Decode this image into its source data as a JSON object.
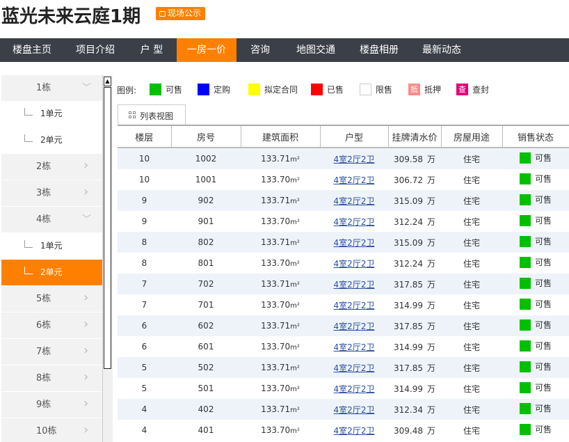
{
  "header": {
    "title": "蓝光未来云庭1期",
    "badge": "现场公示"
  },
  "nav": {
    "items": [
      {
        "label": "楼盘主页"
      },
      {
        "label": "项目介绍"
      },
      {
        "label": "户 型"
      },
      {
        "label": "一房一价"
      },
      {
        "label": "咨询"
      },
      {
        "label": "地图交通"
      },
      {
        "label": "楼盘相册"
      },
      {
        "label": "最新动态"
      }
    ],
    "active_color": "#ff8000",
    "bg_color": "#3b3f48"
  },
  "sidebar": {
    "items": [
      {
        "type": "building",
        "label": "1栋",
        "expanded": true
      },
      {
        "type": "unit",
        "label": "1单元"
      },
      {
        "type": "unit",
        "label": "2单元"
      },
      {
        "type": "building",
        "label": "2栋",
        "expanded": false
      },
      {
        "type": "building",
        "label": "3栋",
        "expanded": false
      },
      {
        "type": "building",
        "label": "4栋",
        "expanded": true
      },
      {
        "type": "unit",
        "label": "1单元"
      },
      {
        "type": "unit",
        "label": "2单元",
        "active": true
      },
      {
        "type": "building",
        "label": "5栋",
        "expanded": false
      },
      {
        "type": "building",
        "label": "6栋",
        "expanded": false
      },
      {
        "type": "building",
        "label": "7栋",
        "expanded": false
      },
      {
        "type": "building",
        "label": "8栋",
        "expanded": false
      },
      {
        "type": "building",
        "label": "9栋",
        "expanded": false
      },
      {
        "type": "building",
        "label": "10栋",
        "expanded": false
      }
    ]
  },
  "legend": {
    "title": "图例:",
    "items": [
      {
        "label": "可售",
        "color": "#00c000",
        "glyph": ""
      },
      {
        "label": "定购",
        "color": "#0000ff",
        "glyph": ""
      },
      {
        "label": "拟定合同",
        "color": "#ffff00",
        "glyph": ""
      },
      {
        "label": "已售",
        "color": "#ff0000",
        "glyph": ""
      },
      {
        "label": "限售",
        "color": "#ffffff",
        "glyph": ""
      },
      {
        "label": "抵押",
        "color": "#ff8a8a",
        "glyph": "抵"
      },
      {
        "label": "查封",
        "color": "#e0007a",
        "glyph": "查"
      }
    ]
  },
  "tab": {
    "label": "列表视图"
  },
  "table": {
    "columns": [
      "楼层",
      "房号",
      "建筑面积",
      "户型",
      "挂牌清水价",
      "房屋用途",
      "销售状态"
    ],
    "area_unit": "m²",
    "price_unit": "万",
    "rows": [
      {
        "floor": "10",
        "room": "1002",
        "area": "133.71",
        "layout": "4室2厅2卫",
        "price": "309.58",
        "usage": "住宅",
        "status": "可售",
        "status_color": "#00c000"
      },
      {
        "floor": "10",
        "room": "1001",
        "area": "133.70",
        "layout": "4室2厅2卫",
        "price": "306.72",
        "usage": "住宅",
        "status": "可售",
        "status_color": "#00c000"
      },
      {
        "floor": "9",
        "room": "902",
        "area": "133.71",
        "layout": "4室2厅2卫",
        "price": "315.09",
        "usage": "住宅",
        "status": "可售",
        "status_color": "#00c000"
      },
      {
        "floor": "9",
        "room": "901",
        "area": "133.70",
        "layout": "4室2厅2卫",
        "price": "312.24",
        "usage": "住宅",
        "status": "可售",
        "status_color": "#00c000"
      },
      {
        "floor": "8",
        "room": "802",
        "area": "133.71",
        "layout": "4室2厅2卫",
        "price": "315.09",
        "usage": "住宅",
        "status": "可售",
        "status_color": "#00c000"
      },
      {
        "floor": "8",
        "room": "801",
        "area": "133.70",
        "layout": "4室2厅2卫",
        "price": "312.24",
        "usage": "住宅",
        "status": "可售",
        "status_color": "#00c000"
      },
      {
        "floor": "7",
        "room": "702",
        "area": "133.71",
        "layout": "4室2厅2卫",
        "price": "317.85",
        "usage": "住宅",
        "status": "可售",
        "status_color": "#00c000"
      },
      {
        "floor": "7",
        "room": "701",
        "area": "133.70",
        "layout": "4室2厅2卫",
        "price": "314.99",
        "usage": "住宅",
        "status": "可售",
        "status_color": "#00c000"
      },
      {
        "floor": "6",
        "room": "602",
        "area": "133.71",
        "layout": "4室2厅2卫",
        "price": "317.85",
        "usage": "住宅",
        "status": "可售",
        "status_color": "#00c000"
      },
      {
        "floor": "6",
        "room": "601",
        "area": "133.70",
        "layout": "4室2厅2卫",
        "price": "314.99",
        "usage": "住宅",
        "status": "可售",
        "status_color": "#00c000"
      },
      {
        "floor": "5",
        "room": "502",
        "area": "133.71",
        "layout": "4室2厅2卫",
        "price": "317.85",
        "usage": "住宅",
        "status": "可售",
        "status_color": "#00c000"
      },
      {
        "floor": "5",
        "room": "501",
        "area": "133.70",
        "layout": "4室2厅2卫",
        "price": "314.99",
        "usage": "住宅",
        "status": "可售",
        "status_color": "#00c000"
      },
      {
        "floor": "4",
        "room": "402",
        "area": "133.71",
        "layout": "4室2厅2卫",
        "price": "312.34",
        "usage": "住宅",
        "status": "可售",
        "status_color": "#00c000"
      },
      {
        "floor": "4",
        "room": "401",
        "area": "133.70",
        "layout": "4室2厅2卫",
        "price": "309.48",
        "usage": "住宅",
        "status": "可售",
        "status_color": "#00c000"
      }
    ]
  }
}
